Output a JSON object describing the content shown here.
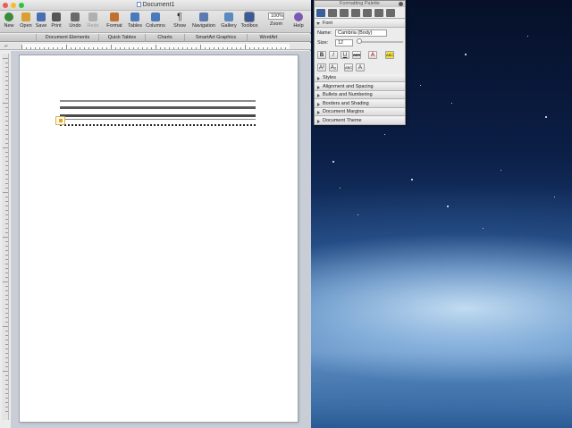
{
  "window": {
    "title": "Document1"
  },
  "toolbar": {
    "items": [
      {
        "id": "new",
        "label": "New",
        "color": "#3a8a3a"
      },
      {
        "id": "open",
        "label": "Open",
        "color": "#d8a030"
      },
      {
        "id": "save",
        "label": "Save",
        "color": "#4a6fb0"
      },
      {
        "id": "print",
        "label": "Print",
        "color": "#555555"
      },
      {
        "id": "undo",
        "label": "Undo",
        "color": "#6a6a6a"
      },
      {
        "id": "redo",
        "label": "Redo",
        "color": "#b0b0b0"
      },
      {
        "id": "format",
        "label": "Format",
        "color": "#c07030"
      },
      {
        "id": "tables",
        "label": "Tables",
        "color": "#4a7ab8"
      },
      {
        "id": "columns",
        "label": "Columns",
        "color": "#4a7ab8"
      },
      {
        "id": "show",
        "label": "Show",
        "color": "#333333"
      },
      {
        "id": "navigation",
        "label": "Navigation",
        "color": "#5a7ab0"
      },
      {
        "id": "gallery",
        "label": "Gallery",
        "color": "#5a8ac0"
      },
      {
        "id": "toolbox",
        "label": "Toolbox",
        "color": "#3a5a9a"
      },
      {
        "id": "help",
        "label": "Help",
        "color": "#7a5ab0"
      }
    ],
    "zoom": {
      "label": "Zoom",
      "value": "100%"
    }
  },
  "ribbon": {
    "tabs": [
      "Document Elements",
      "Quick Tables",
      "Charts",
      "SmartArt Graphics",
      "WordArt"
    ]
  },
  "palette": {
    "title": "Formatting Palette",
    "font_section": "Font",
    "name_label": "Name:",
    "name_value": "Cambria (Body)",
    "size_label": "Size:",
    "size_value": "12",
    "bold": "B",
    "italic": "I",
    "underline": "U",
    "strike": "ABC",
    "font_color": "A",
    "highlight": "ABC",
    "superscript": "A²",
    "subscript": "A₂",
    "small_caps": "ABC",
    "clear": "A",
    "sections": [
      "Styles",
      "Alignment and Spacing",
      "Bullets and Numbering",
      "Borders and Shading",
      "Document Margins",
      "Document Theme"
    ]
  },
  "colors": {
    "accent": "#3b5f9a",
    "font_color_red": "#d02020",
    "highlight_yellow": "#f0e040"
  }
}
